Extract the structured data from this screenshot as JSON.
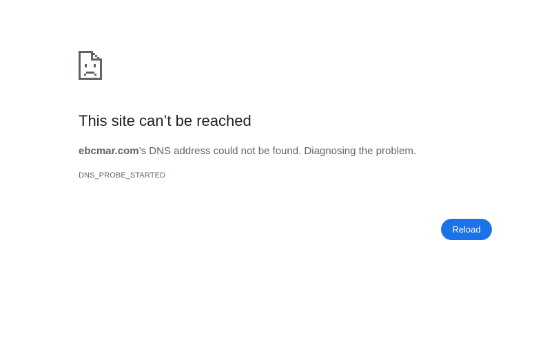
{
  "error_page": {
    "icon": "sad-page-icon",
    "title": "This site can’t be reached",
    "summary": {
      "domain": "ebcmar.com",
      "message": "’s DNS address could not be found. Diagnosing the problem."
    },
    "error_code": "DNS_PROBE_STARTED",
    "reload_label": "Reload"
  },
  "colors": {
    "background": "#ffffff",
    "title_text": "#202124",
    "body_text": "#5f6368",
    "icon_stroke": "#5f6368",
    "button_background": "#1a73e8",
    "button_text": "#ffffff"
  }
}
